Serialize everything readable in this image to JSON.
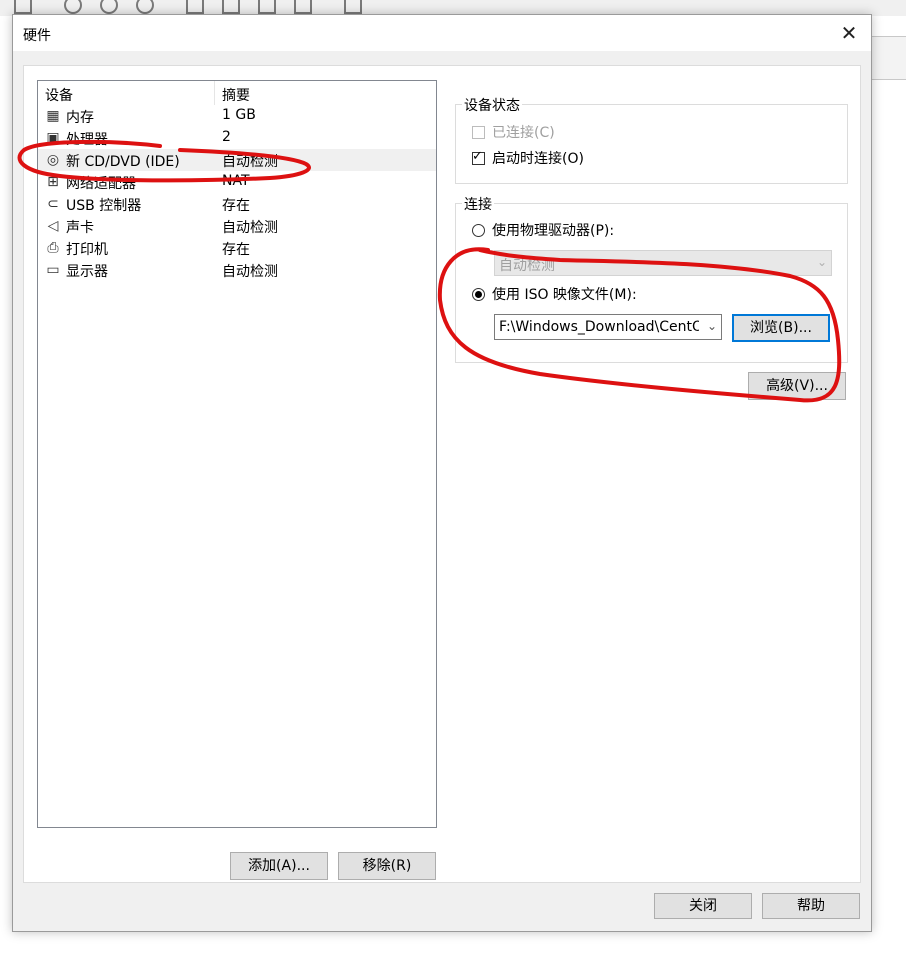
{
  "dialog": {
    "title": "硬件",
    "close_glyph": "✕"
  },
  "device_list": {
    "header_device": "设备",
    "header_summary": "摘要",
    "items": [
      {
        "icon": "memory-icon",
        "glyph": "▦",
        "name": "内存",
        "summary": "1 GB"
      },
      {
        "icon": "processor-icon",
        "glyph": "▣",
        "name": "处理器",
        "summary": "2"
      },
      {
        "icon": "cd-dvd-icon",
        "glyph": "◎",
        "name": "新 CD/DVD (IDE)",
        "summary": "自动检测"
      },
      {
        "icon": "network-adapter-icon",
        "glyph": "⊞",
        "name": "网络适配器",
        "summary": "NAT"
      },
      {
        "icon": "usb-icon",
        "glyph": "⊂",
        "name": "USB 控制器",
        "summary": "存在"
      },
      {
        "icon": "sound-icon",
        "glyph": "◁",
        "name": "声卡",
        "summary": "自动检测"
      },
      {
        "icon": "printer-icon",
        "glyph": "⎙",
        "name": "打印机",
        "summary": "存在"
      },
      {
        "icon": "display-icon",
        "glyph": "▭",
        "name": "显示器",
        "summary": "自动检测"
      }
    ],
    "selected_index": 2
  },
  "buttons": {
    "add": "添加(A)...",
    "remove": "移除(R)",
    "browse": "浏览(B)...",
    "advanced": "高级(V)...",
    "close": "关闭",
    "help": "帮助"
  },
  "device_status": {
    "title": "设备状态",
    "connected_label": "已连接(C)",
    "connected_checked": false,
    "connect_at_power_on_label": "启动时连接(O)",
    "connect_at_power_on_checked": true
  },
  "connection": {
    "title": "连接",
    "physical_drive_label": "使用物理驱动器(P):",
    "physical_drive_value": "自动检测",
    "iso_label": "使用 ISO 映像文件(M):",
    "iso_path": "F:\\Windows_Download\\CentOS",
    "selected": "iso"
  },
  "colors": {
    "accent": "#0078d7",
    "annotation": "#dd1111"
  }
}
